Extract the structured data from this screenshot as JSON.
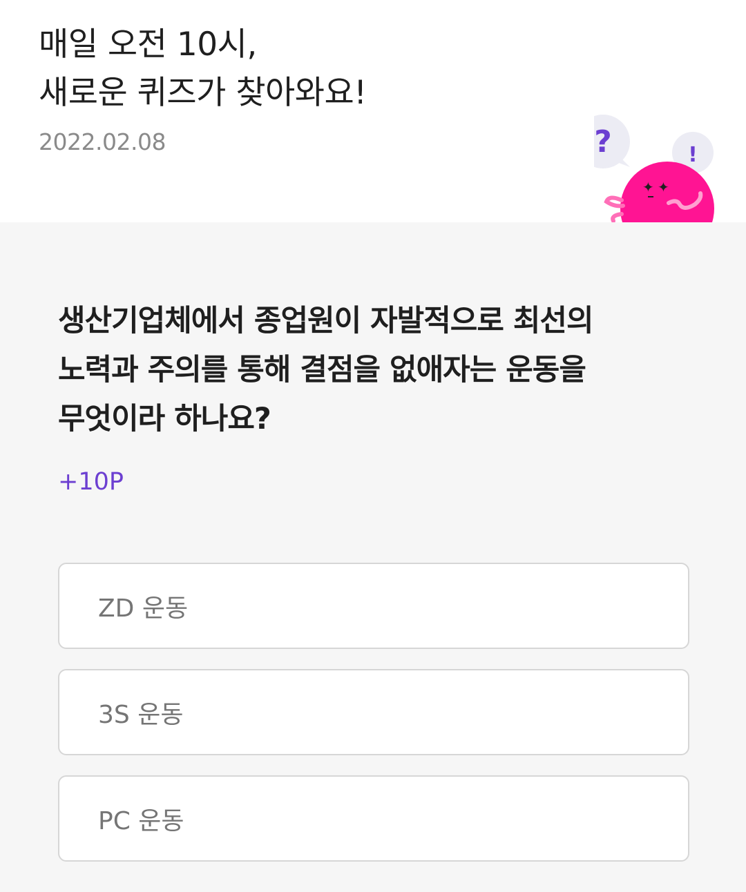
{
  "header": {
    "headline_line1": "매일 오전 10시,",
    "headline_line2": "새로운 퀴즈가 찾아와요!",
    "date": "2022.02.08",
    "mascot": {
      "icon": "pink-character-illustration",
      "bubble_question": "?",
      "bubble_exclaim": "!"
    }
  },
  "quiz": {
    "question_line1": "생산기업체에서 종업원이 자발적으로 최선의",
    "question_line2": "노력과 주의를 통해 결점을 없애자는 운동을",
    "question_line3": "무엇이라 하나요?",
    "points": "+10P",
    "options": [
      {
        "label": "ZD 운동"
      },
      {
        "label": "3S 운동"
      },
      {
        "label": "PC 운동"
      }
    ]
  },
  "colors": {
    "accent": "#6c3fd1",
    "mascot_pink": "#ff1493",
    "background": "#f6f6f6"
  }
}
